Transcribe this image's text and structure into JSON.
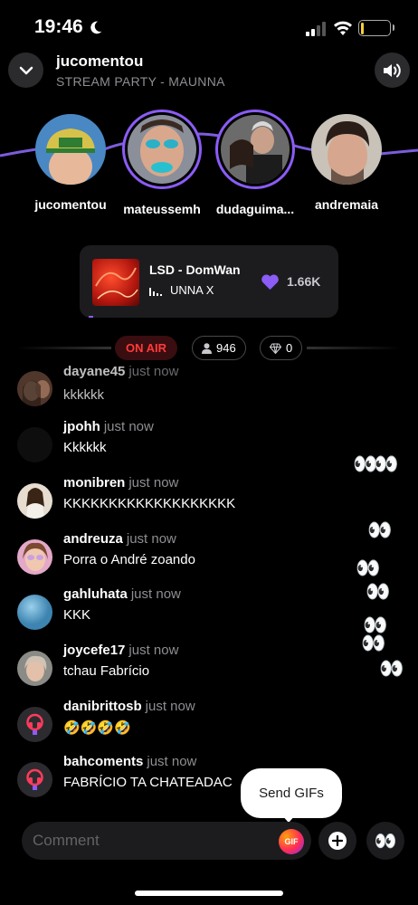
{
  "status_bar": {
    "time": "19:46",
    "battery": "10",
    "battery_percent": 10
  },
  "header": {
    "title": "jucomentou",
    "subtitle": "STREAM PARTY - MAUNNA"
  },
  "participants": [
    {
      "name": "jucomentou",
      "active": false
    },
    {
      "name": "mateussemh",
      "active": true
    },
    {
      "name": "dudaguima...",
      "active": true
    },
    {
      "name": "andremaia",
      "active": false
    }
  ],
  "now_playing": {
    "title": "LSD - DomWan",
    "artist": "UNNA X",
    "likes": "1.66K",
    "progress": 0.02
  },
  "live": {
    "on_air": "ON AIR",
    "listeners": "946",
    "diamonds": "0"
  },
  "chat": [
    {
      "user": "dayane45",
      "time": "just now",
      "text": "kkkkkk"
    },
    {
      "user": "jpohh",
      "time": "just now",
      "text": "Kkkkkk"
    },
    {
      "user": "monibren",
      "time": "just now",
      "text": "KKKKKKKKKKKKKKKKKKK"
    },
    {
      "user": "andreuza",
      "time": "just now",
      "text": "Porra o André zoando"
    },
    {
      "user": "gahluhata",
      "time": "just now",
      "text": "KKK"
    },
    {
      "user": "joycefe17",
      "time": "just now",
      "text": "tchau Fabrício"
    },
    {
      "user": "danibrittosb",
      "time": "just now",
      "text": "🤣🤣🤣🤣"
    },
    {
      "user": "bahcoments",
      "time": "just now",
      "text": "FABRÍCIO TA CHATEADAC"
    }
  ],
  "reactions": "👀",
  "tooltip": "Send GIFs",
  "composer": {
    "placeholder": "Comment",
    "gif_label": "GIF",
    "eyes_button": "👀"
  },
  "colors": {
    "accent": "#8b5cf6",
    "on_air": "#ff3b3b",
    "background": "#000000",
    "card": "#1c1c1f"
  }
}
